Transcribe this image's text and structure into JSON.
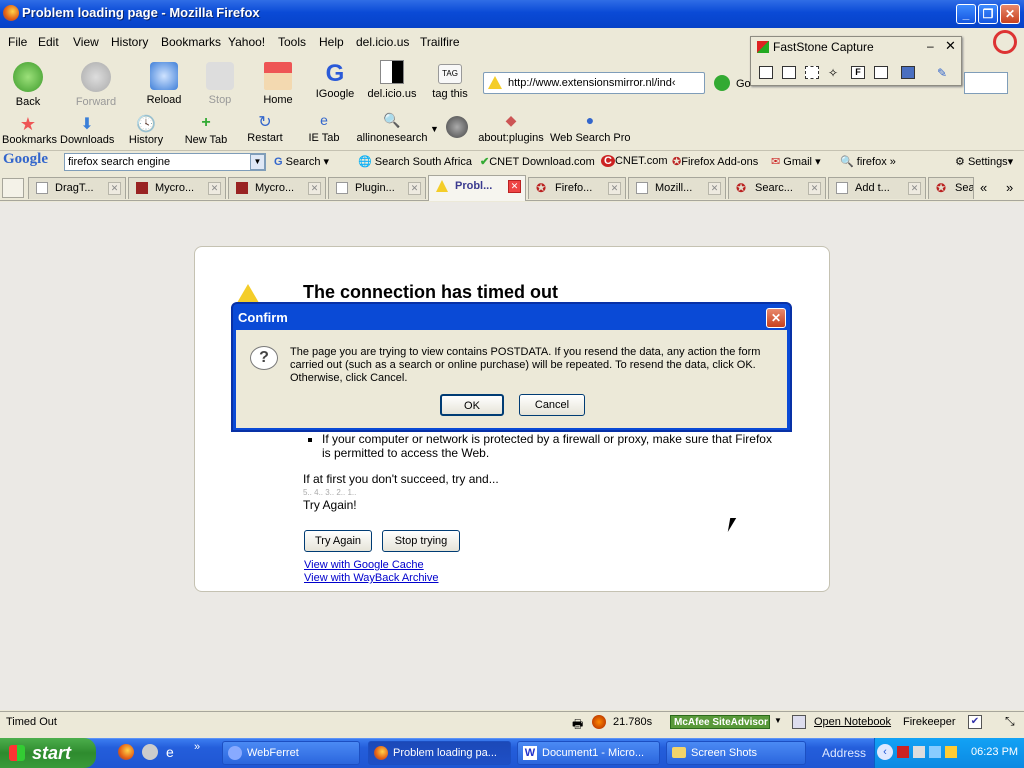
{
  "window": {
    "title": "Problem loading page - Mozilla Firefox"
  },
  "menu": [
    "File",
    "Edit",
    "View",
    "History",
    "Bookmarks",
    "Yahoo!",
    "Tools",
    "Help",
    "del.icio.us",
    "Trailfire"
  ],
  "nav": {
    "back": "Back",
    "forward": "Forward",
    "reload": "Reload",
    "stop": "Stop",
    "home": "Home",
    "igoogle": "IGoogle",
    "delicious": "del.icio.us",
    "tag": "tag this",
    "tag_badge": "TAG",
    "url": "http://www.extensionsmirror.nl/ind‹",
    "go": "Go"
  },
  "bookmarks": [
    "Bookmarks",
    "Downloads",
    "History",
    "New Tab",
    "Restart",
    "IE Tab",
    "allinonesearch",
    "about:plugins",
    "Web Search Pro"
  ],
  "google": {
    "logo": "Google",
    "query": "firefox search engine",
    "search": "Search",
    "links": [
      "Search South Africa",
      "CNET Download.com",
      "CNET.com",
      "Firefox Add-ons",
      "Gmail",
      "firefox"
    ],
    "more": "»",
    "settings": "Settings▾"
  },
  "tabs": [
    "DragT...",
    "Mycro...",
    "Mycro...",
    "Plugin...",
    "Probl...",
    "Firefo...",
    "Mozill...",
    "Searc...",
    "Add t...",
    "Sea"
  ],
  "tab_scroll": [
    "«",
    "»"
  ],
  "error": {
    "title": "The connection has timed out",
    "bullet": "If your computer or network is protected by a firewall or proxy, make sure that Firefox is permitted to access the Web.",
    "retry_text": "If at first you don't succeed, try and...",
    "countdown": "5.. 4.. 3.. 2.. 1..",
    "try_again_text": "Try Again!",
    "btn_try": "Try Again",
    "btn_stop": "Stop trying",
    "link_cache": "View with Google Cache",
    "link_wayback": "View with WayBack Archive"
  },
  "dialog": {
    "title": "Confirm",
    "message": "The page you are trying to view contains POSTDATA. If you resend the data, any action the form carried out (such as a search or online purchase) will be repeated. To resend the data, click OK. Otherwise, click Cancel.",
    "ok": "OK",
    "cancel": "Cancel"
  },
  "faststone": {
    "title": "FastStone Capture"
  },
  "status": {
    "text": "Timed Out",
    "time": "21.780s",
    "mcafee": "McAfee SiteAdvisor",
    "notebook": "Open Notebook",
    "firekeeper": "Firekeeper"
  },
  "taskbar": {
    "start": "start",
    "items": [
      "WebFerret",
      "Problem loading pa...",
      "Document1 - Micro...",
      "Screen Shots"
    ],
    "address": "Address",
    "clock": "06:23 PM"
  }
}
